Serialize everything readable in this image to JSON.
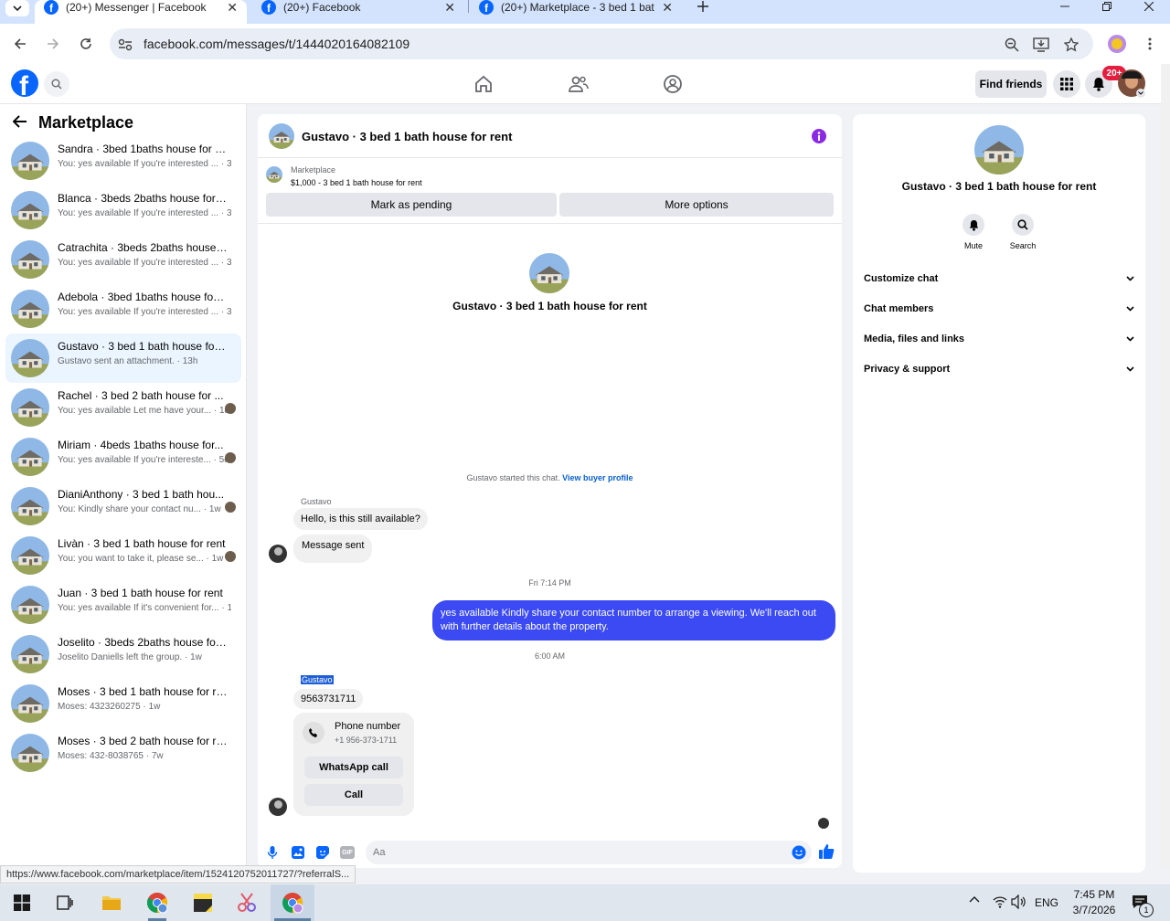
{
  "browser": {
    "tabs": [
      {
        "title": "(20+) Messenger | Facebook",
        "active": true
      },
      {
        "title": "(20+) Facebook",
        "active": false
      },
      {
        "title": "(20+) Marketplace - 3 bed 1 bat",
        "active": false
      }
    ],
    "url": "facebook.com/messages/t/1444020164082109",
    "status_url": "https://www.facebook.com/marketplace/item/1524120752011727/?referralS..."
  },
  "fb": {
    "find_friends": "Find friends",
    "notif_badge": "20+",
    "brand_color": "#0866ff"
  },
  "sidebar": {
    "title": "Marketplace",
    "conversations": [
      {
        "name": "Sandra · 3bed 1baths house for re...",
        "preview": "You: yes available If you're interested ... · 3m"
      },
      {
        "name": "Blanca · 3beds 2baths house for re...",
        "preview": "You: yes available If you're interested ... · 3m"
      },
      {
        "name": "Catrachita · 3beds 2baths house fo...",
        "preview": "You: yes available If you're interested ... · 3m"
      },
      {
        "name": "Adebola · 3bed 1baths house for r...",
        "preview": "You: yes available If you're interested ... · 3m"
      },
      {
        "name": "Gustavo · 3 bed 1 bath house for r...",
        "preview": "Gustavo sent an attachment. · 13h"
      },
      {
        "name": "Rachel · 3 bed 2 bath house for ...",
        "preview": "You: yes available Let me have your... · 1d"
      },
      {
        "name": "Miriam · 4beds 1baths house for...",
        "preview": "You: yes available If you're intereste... · 5d"
      },
      {
        "name": "DianiAnthony · 3 bed 1 bath hou...",
        "preview": "You: Kindly share your contact nu... · 1w"
      },
      {
        "name": "Livàn · 3 bed 1 bath house for rent",
        "preview": "You: you want to take it, please se... · 1w"
      },
      {
        "name": "Juan · 3 bed 1 bath house for rent",
        "preview": "You: yes available If it's convenient for... · 1w"
      },
      {
        "name": "Joselito · 3beds 2baths house for r...",
        "preview": "Joselito Daniells left the group. · 1w"
      },
      {
        "name": "Moses · 3 bed 1 bath house for rent",
        "preview": "Moses: 4323260275 · 1w"
      },
      {
        "name": "Moses · 3 bed 2 bath house for rent",
        "preview": "Moses: 432-8038765 · 7w"
      }
    ]
  },
  "chat": {
    "title": "Gustavo · 3 bed 1 bath house for rent",
    "marketplace_label": "Marketplace",
    "listing": "$1,000 - 3 bed 1 bath house for rent",
    "mark_pending": "Mark as pending",
    "more_options": "More options",
    "intro_name": "Gustavo · 3 bed 1 bath house for rent",
    "started": "Gustavo started this chat.",
    "view_buyer": "View buyer profile",
    "sender1": "Gustavo",
    "msg1": "Hello, is this still available?",
    "msg2": "Message sent",
    "time1": "Fri 7:14 PM",
    "msg_out": "yes available Kindly share your contact number to arrange a viewing. We'll reach out with further details about the property.",
    "time2": "6:00 AM",
    "sender2": "Gustavo",
    "msg3": "9563731711",
    "phone_title": "Phone number",
    "phone_number": "+1 956-373-1711",
    "whatsapp": "WhatsApp call",
    "call": "Call",
    "input_placeholder": "Aa",
    "accent": "#3b4af2"
  },
  "info": {
    "title": "Gustavo · 3 bed 1 bath house for rent",
    "mute": "Mute",
    "search": "Search",
    "sections": [
      "Customize chat",
      "Chat members",
      "Media, files and links",
      "Privacy & support"
    ]
  },
  "taskbar": {
    "lang": "ENG",
    "time": "7:45 PM",
    "date": "3/7/2026",
    "notif_count": "1"
  }
}
